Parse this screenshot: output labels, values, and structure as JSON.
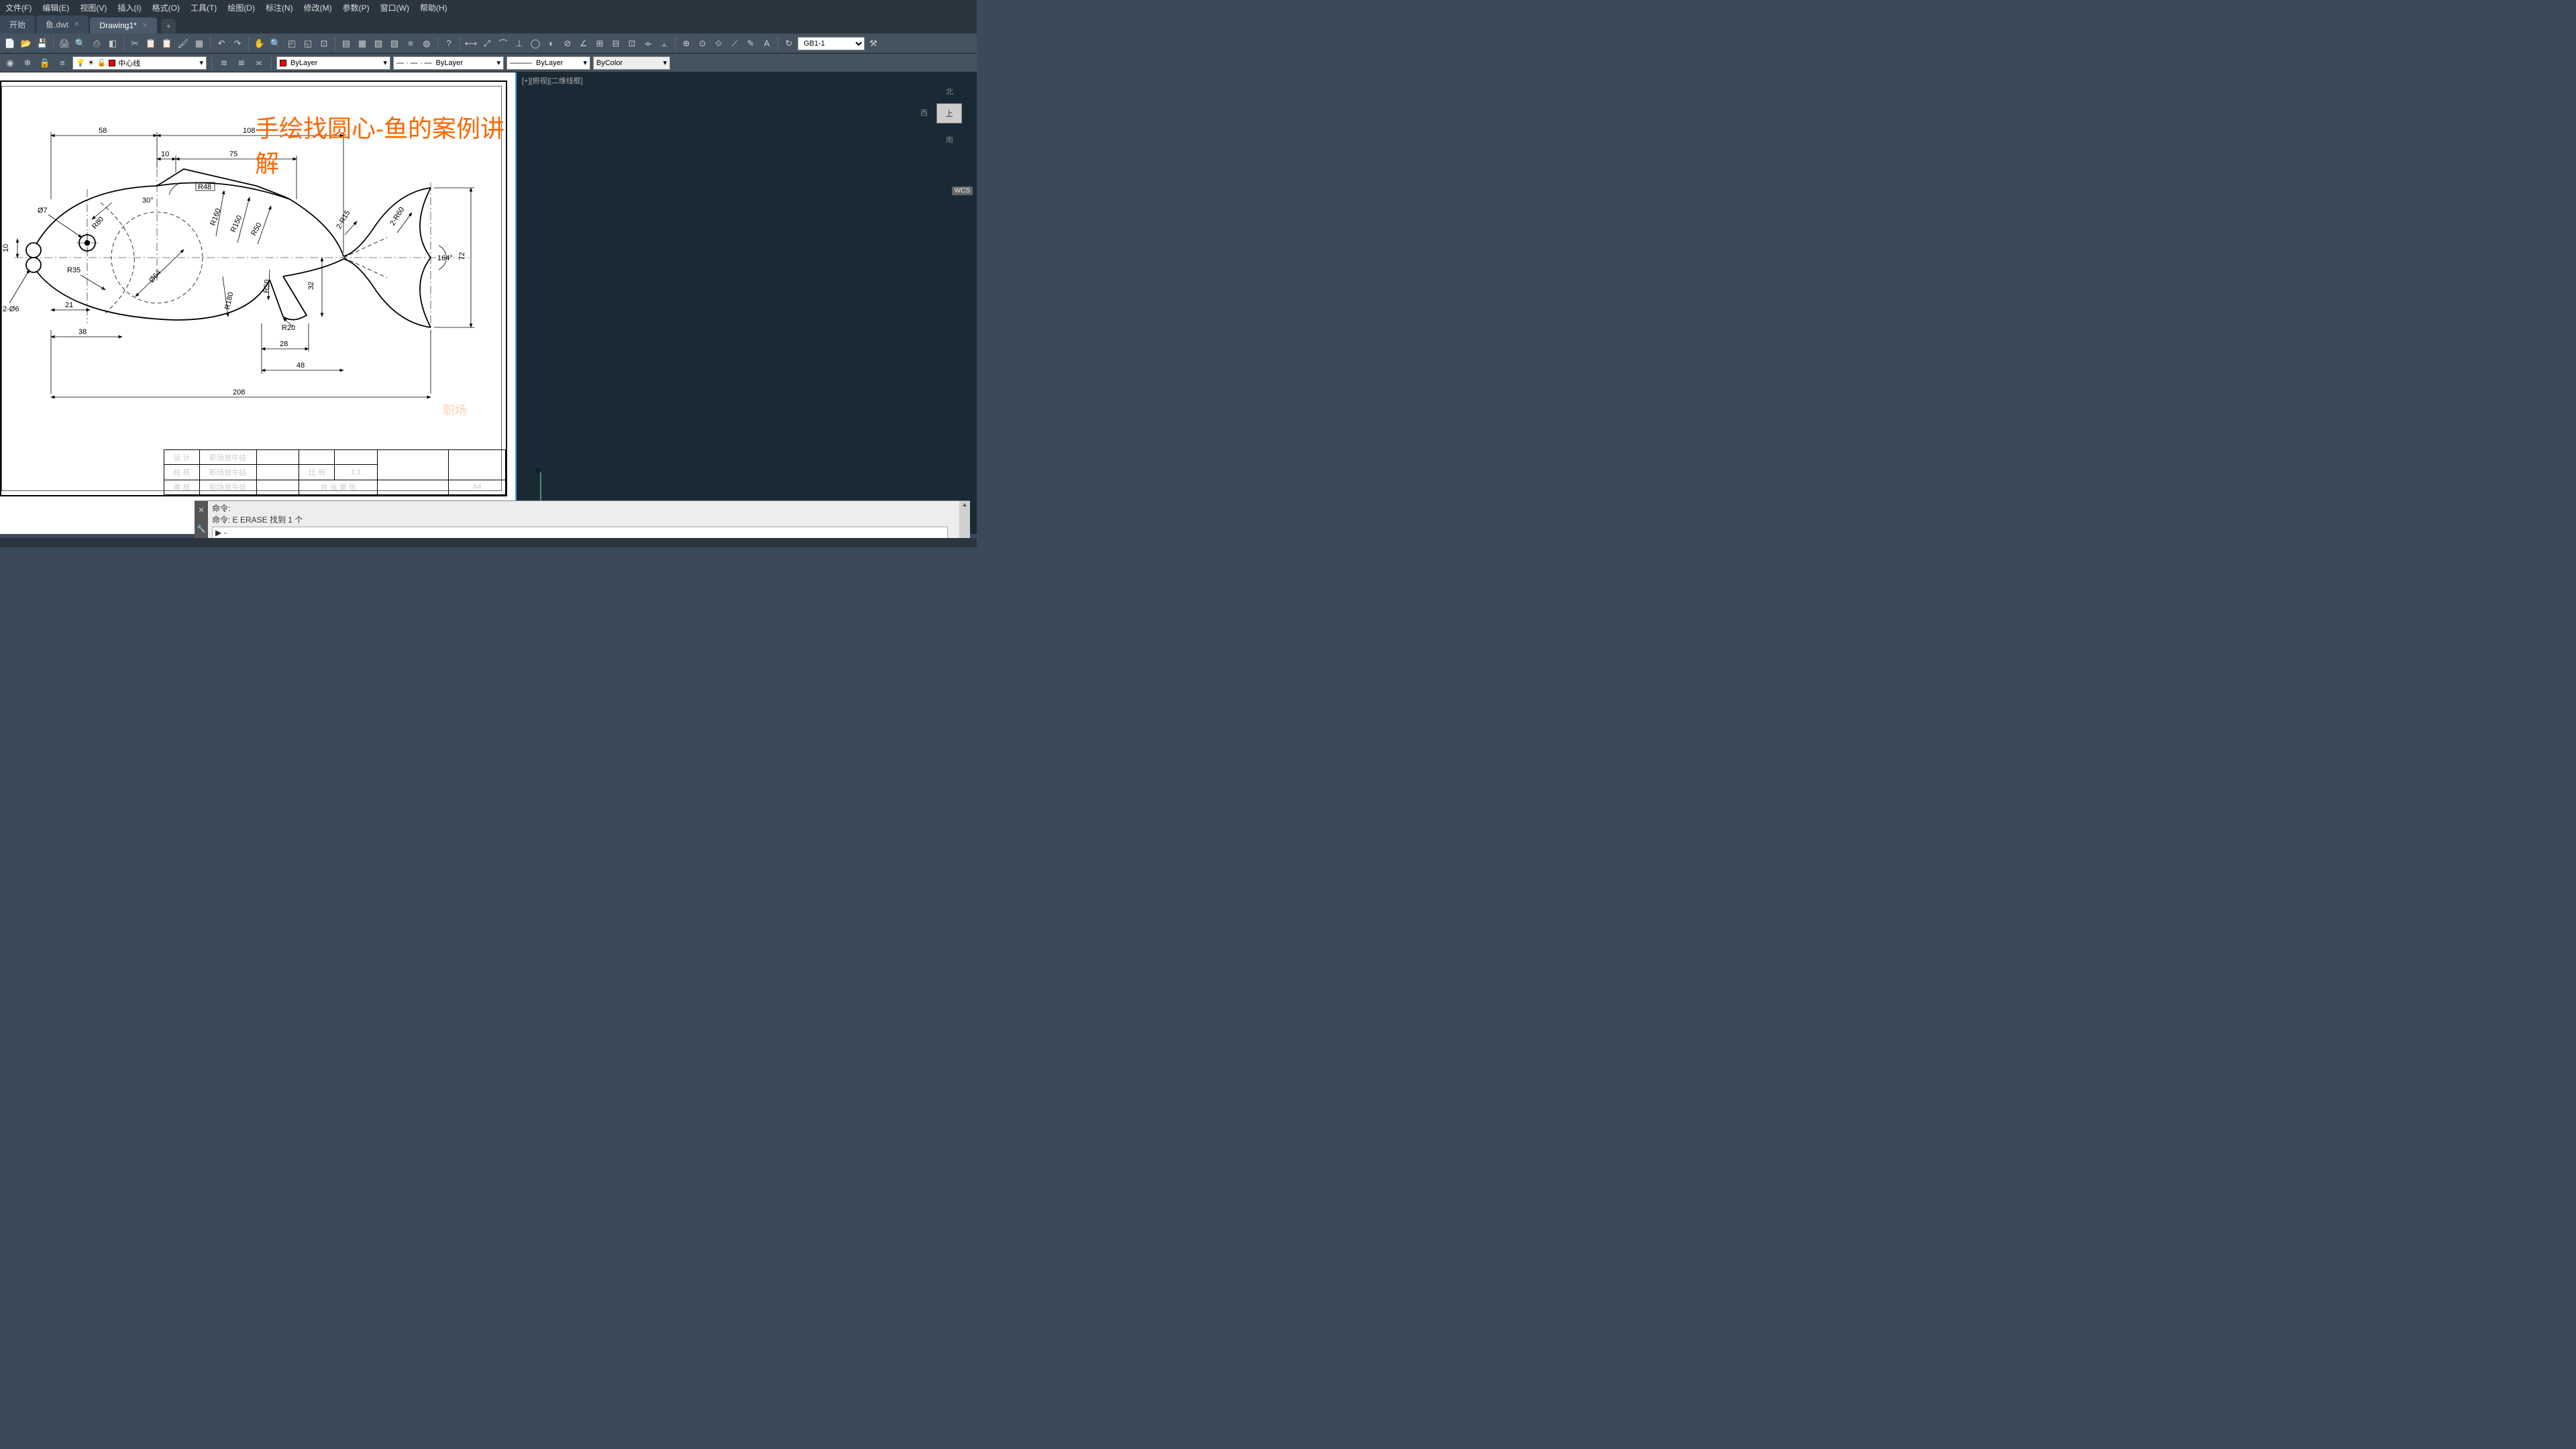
{
  "menu": {
    "file": "文件(F)",
    "edit": "编辑(E)",
    "view": "视图(V)",
    "insert": "插入(I)",
    "format": "格式(O)",
    "tools": "工具(T)",
    "draw": "绘图(D)",
    "dim": "标注(N)",
    "modify": "修改(M)",
    "param": "参数(P)",
    "window": "窗口(W)",
    "help": "帮助(H)"
  },
  "tabs": {
    "start": "开始",
    "t1": "鱼.dwt",
    "t2": "Drawing1*"
  },
  "layer": {
    "current": "中心线"
  },
  "props": {
    "color": "ByLayer",
    "linetype": "ByLayer",
    "lineweight": "ByLayer",
    "plotcolor": "ByColor"
  },
  "dimstyle": "GB1-1",
  "viewport": {
    "label": "[+][俯视][二维线框]",
    "north": "北",
    "west": "西",
    "south": "南",
    "face": "上",
    "wcs": "WCS"
  },
  "overlay": {
    "title": "手绘找圆心-鱼的案例讲解",
    "watermark": "职场"
  },
  "cmd": {
    "l1": "命令:",
    "l2": "命令: E ERASE 找到 1 个",
    "prompt": "▶ -"
  },
  "titleblock": {
    "r1c1": "设 计",
    "r1c2": "职场放牛娃",
    "r2c1": "校 核",
    "r2c2": "职场放牛娃",
    "r2c3": "比 例",
    "r2c4": "1:1",
    "r3c1": "审 核",
    "r3c2": "职场放牛娃",
    "r3c3": "共  张 第  张",
    "r3c4": "A4"
  },
  "dims": {
    "d58": "58",
    "d108": "108",
    "d10": "10",
    "d75": "75",
    "d208": "208",
    "d38": "38",
    "d21": "21",
    "d28": "28",
    "d48": "48",
    "d32": "32",
    "d72": "72",
    "h10": "10",
    "phi7": "Ø7",
    "phi6": "2-Ø6",
    "phi64": "Ø64",
    "r80": "R80",
    "r35": "R35",
    "r160": "R160",
    "r150": "R150",
    "r50a": "R50",
    "r180": "R180",
    "r50b": "R50",
    "r20": "R20",
    "r15": "2-R15",
    "r60": "2-R60",
    "a30": "30°",
    "a164": "164°",
    "ang": "R48"
  }
}
